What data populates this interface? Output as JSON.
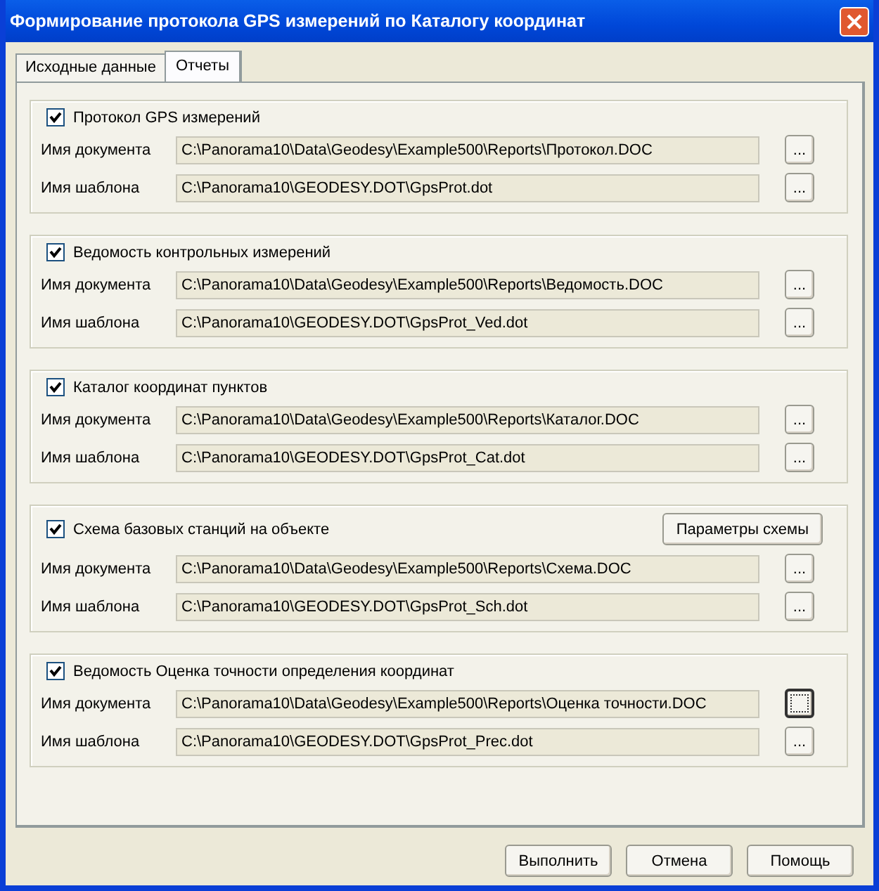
{
  "window": {
    "title": "Формирование протокола GPS измерений по Каталогу координат"
  },
  "tabs": [
    {
      "label": "Исходные данные",
      "selected": false
    },
    {
      "label": "Отчеты",
      "selected": true
    }
  ],
  "groups": [
    {
      "label": "Протокол GPS измерений",
      "checked": true,
      "fields": [
        {
          "label": "Имя документа",
          "value": "C:\\Panorama10\\Data\\Geodesy\\Example500\\Reports\\Протокол.DOC",
          "browse": {
            "label": "...",
            "focused": false
          }
        },
        {
          "label": "Имя шаблона",
          "value": "C:\\Panorama10\\GEODESY.DOT\\GpsProt.dot",
          "browse": {
            "label": "...",
            "focused": false
          }
        }
      ]
    },
    {
      "label": "Ведомость контрольных измерений",
      "checked": true,
      "fields": [
        {
          "label": "Имя документа",
          "value": "C:\\Panorama10\\Data\\Geodesy\\Example500\\Reports\\Ведомость.DOC",
          "browse": {
            "label": "...",
            "focused": false
          }
        },
        {
          "label": "Имя шаблона",
          "value": "C:\\Panorama10\\GEODESY.DOT\\GpsProt_Ved.dot",
          "browse": {
            "label": "...",
            "focused": false
          }
        }
      ]
    },
    {
      "label": "Каталог координат пунктов",
      "checked": true,
      "fields": [
        {
          "label": "Имя документа",
          "value": "C:\\Panorama10\\Data\\Geodesy\\Example500\\Reports\\Каталог.DOC",
          "browse": {
            "label": "...",
            "focused": false
          }
        },
        {
          "label": "Имя шаблона",
          "value": "C:\\Panorama10\\GEODESY.DOT\\GpsProt_Cat.dot",
          "browse": {
            "label": "...",
            "focused": false
          }
        }
      ]
    },
    {
      "label": "Схема базовых станций на объекте",
      "checked": true,
      "options_button": "Параметры схемы",
      "fields": [
        {
          "label": "Имя документа",
          "value": "C:\\Panorama10\\Data\\Geodesy\\Example500\\Reports\\Схема.DOC",
          "browse": {
            "label": "...",
            "focused": false
          }
        },
        {
          "label": "Имя шаблона",
          "value": "C:\\Panorama10\\GEODESY.DOT\\GpsProt_Sch.dot",
          "browse": {
            "label": "...",
            "focused": false
          }
        }
      ]
    },
    {
      "label": "Ведомость Оценка точности определения координат",
      "checked": true,
      "fields": [
        {
          "label": "Имя документа",
          "value": "C:\\Panorama10\\Data\\Geodesy\\Example500\\Reports\\Оценка точности.DOC",
          "browse": {
            "focused": true
          }
        },
        {
          "label": "Имя шаблона",
          "value": "C:\\Panorama10\\GEODESY.DOT\\GpsProt_Prec.dot",
          "browse": {
            "label": "...",
            "focused": false
          }
        }
      ]
    }
  ],
  "buttons": [
    "Выполнить",
    "Отмена",
    "Помощь"
  ]
}
